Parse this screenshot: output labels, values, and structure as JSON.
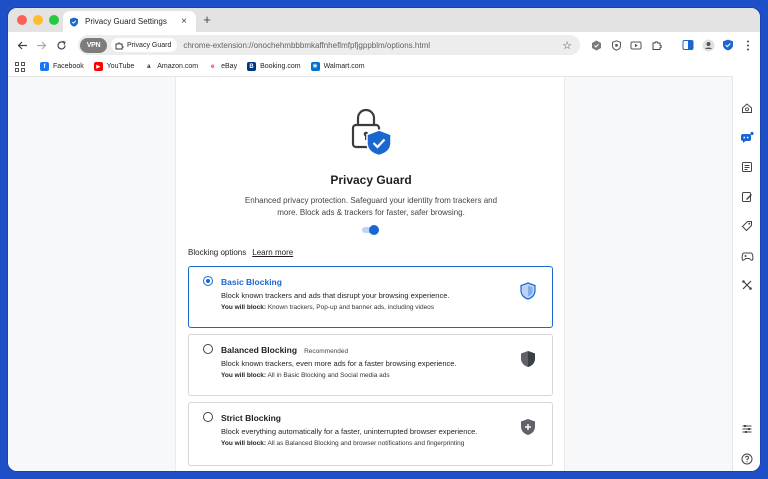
{
  "browser": {
    "tab_title": "Privacy Guard Settings",
    "tab_close": "×",
    "new_tab": "+",
    "vpn_label": "VPN",
    "chip_label": "Privacy Guard",
    "url": "chrome-extension://onochehmbbbmkaffnheflmfpfjgppblm/options.html"
  },
  "bookmarks": [
    {
      "label": "Facebook",
      "icon": "facebook-icon",
      "color": "#1877f2",
      "glyph": "f"
    },
    {
      "label": "YouTube",
      "icon": "youtube-icon",
      "color": "#ff0000",
      "glyph": "▶"
    },
    {
      "label": "Amazon.com",
      "icon": "amazon-icon",
      "color": "#222222",
      "glyph": "a"
    },
    {
      "label": "eBay",
      "icon": "ebay-icon",
      "color": "#e53238",
      "glyph": "e"
    },
    {
      "label": "Booking.com",
      "icon": "booking-icon",
      "color": "#003580",
      "glyph": "B"
    },
    {
      "label": "Walmart.com",
      "icon": "walmart-icon",
      "color": "#0071ce",
      "glyph": "✳"
    }
  ],
  "page": {
    "title": "Privacy Guard",
    "description": "Enhanced privacy protection. Safeguard your identity from trackers and more. Block ads & trackers for faster, safer browsing.",
    "enabled": true,
    "options_heading": "Blocking options",
    "learn_more": "Learn more"
  },
  "options": [
    {
      "title": "Basic Blocking",
      "badge": "",
      "description": "Block known trackers and ads that disrupt your browsing experience.",
      "block_label": "You will block:",
      "block_text": " Known trackers, Pop-up and banner ads, including videos",
      "selected": true
    },
    {
      "title": "Balanced Blocking",
      "badge": "Recommended",
      "description": "Block known trackers, even more ads for a faster browsing experience.",
      "block_label": "You will block:",
      "block_text": " All in Basic Blocking and Social media ads",
      "selected": false
    },
    {
      "title": "Strict Blocking",
      "badge": "",
      "description": "Block everything automatically for a faster, uninterrupted browser experience.",
      "block_label": "You will block:",
      "block_text": " All as Balanced Blocking and browser notifications and fingerprinting",
      "selected": false
    }
  ],
  "colors": {
    "accent": "#1a67d2",
    "frame": "#1d4fc6"
  }
}
